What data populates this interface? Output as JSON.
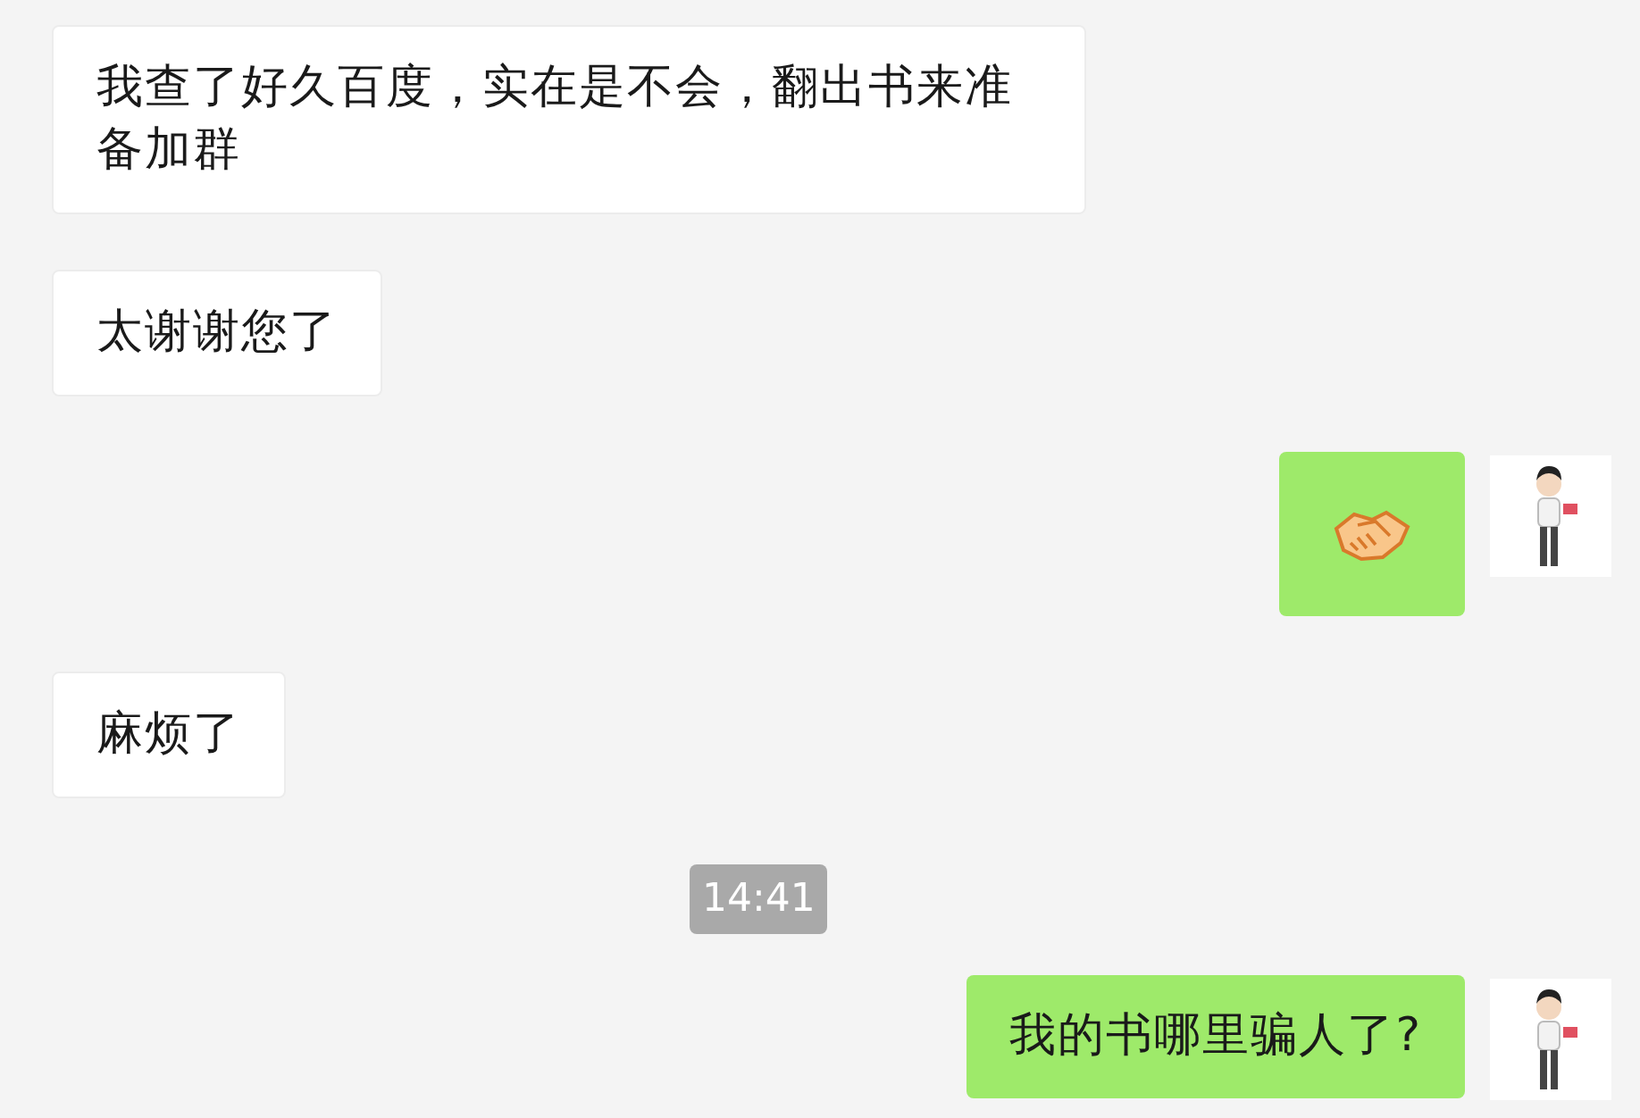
{
  "messages": [
    {
      "kind": "text",
      "outgoing": false,
      "text": "我查了好久百度，实在是不会，翻出书来准备加群"
    },
    {
      "kind": "text",
      "outgoing": false,
      "text": "太谢谢您了"
    },
    {
      "kind": "emoji",
      "outgoing": true
    },
    {
      "kind": "text",
      "outgoing": false,
      "text": "麻烦了"
    },
    {
      "kind": "time",
      "text": "14:41"
    },
    {
      "kind": "text",
      "outgoing": true,
      "text": "我的书哪里骗人了?"
    }
  ]
}
